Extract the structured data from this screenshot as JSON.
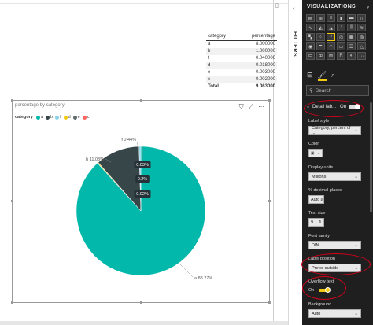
{
  "table": {
    "headers": [
      "category",
      "percentage"
    ],
    "rows": [
      {
        "category": "a",
        "percentage": "8.000000"
      },
      {
        "category": "b",
        "percentage": "1.000000"
      },
      {
        "category": "f",
        "percentage": "0.040000"
      },
      {
        "category": "d",
        "percentage": "0.018000"
      },
      {
        "category": "e",
        "percentage": "0.003000"
      },
      {
        "category": "c",
        "percentage": "0.002000"
      }
    ],
    "total_label": "Total",
    "total_value": "9.063000"
  },
  "filters": {
    "label": "FILTERS"
  },
  "viz": {
    "title": "VISUALIZATIONS",
    "search_placeholder": "Search",
    "detail_section_title": "Detail lab...",
    "detail_toggle_text": "On",
    "fields": {
      "label_style": {
        "label": "Label style",
        "value": "Category, percent of ..."
      },
      "color": {
        "label": "Color"
      },
      "display_units": {
        "label": "Display units",
        "value": "Millions"
      },
      "decimal_places": {
        "label": "% decimal places",
        "value": "Auto"
      },
      "text_size": {
        "label": "Text size",
        "value": "9"
      },
      "font_family": {
        "label": "Font family",
        "value": "DIN"
      },
      "label_position": {
        "label": "Label position",
        "value": "Prefer outside"
      },
      "overflow_text": {
        "label": "Overflow text",
        "toggle_text": "On"
      },
      "background": {
        "label": "Background",
        "value": "Auto"
      }
    },
    "accent_color": "#f2c811"
  },
  "chart_data": {
    "type": "pie",
    "title": "percentage by category",
    "legend_title": "category",
    "legend_position": "top-left",
    "categories": [
      "a",
      "b",
      "f",
      "d",
      "e",
      "c"
    ],
    "values": [
      8.0,
      1.0,
      0.04,
      0.018,
      0.003,
      0.002
    ],
    "colors": {
      "a": "#01b8aa",
      "b": "#374649",
      "c": "#fd625e",
      "d": "#f2c80f",
      "e": "#5f6b6d",
      "f": "#8ad4eb"
    },
    "legend_order": [
      "a",
      "b",
      "f",
      "d",
      "e",
      "c"
    ],
    "data_labels": [
      {
        "category": "a",
        "text": "a 88.27%"
      },
      {
        "category": "b",
        "text": "b 11.03%"
      },
      {
        "category": "f",
        "text": "f 0.44%"
      },
      {
        "category": "d",
        "text": "0.03%"
      },
      {
        "category": "e",
        "text": "0.2%"
      },
      {
        "category": "c",
        "text": "0.02%"
      }
    ]
  }
}
